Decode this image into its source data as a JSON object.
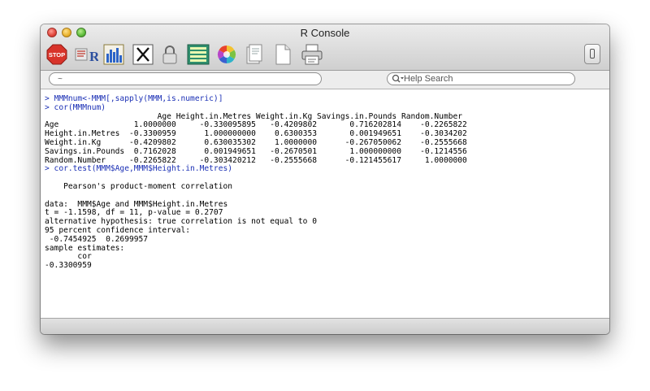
{
  "window": {
    "title": "R Console"
  },
  "toolbar": {
    "stop_label": "STOP"
  },
  "pathbar": {
    "path": "~"
  },
  "search": {
    "placeholder": "Help Search"
  },
  "console": {
    "lines": [
      {
        "kind": "cmd",
        "text": "> MMMnum<-MMM[,sapply(MMM,is.numeric)]"
      },
      {
        "kind": "cmd",
        "text": "> cor(MMMnum)"
      },
      {
        "kind": "out",
        "text": "                        Age Height.in.Metres Weight.in.Kg Savings.in.Pounds Random.Number"
      },
      {
        "kind": "out",
        "text": "Age                1.0000000     -0.330095895   -0.4209802       0.716202814    -0.2265822"
      },
      {
        "kind": "out",
        "text": "Height.in.Metres  -0.3300959      1.000000000    0.6300353       0.001949651    -0.3034202"
      },
      {
        "kind": "out",
        "text": "Weight.in.Kg      -0.4209802      0.630035302    1.0000000      -0.267050062    -0.2555668"
      },
      {
        "kind": "out",
        "text": "Savings.in.Pounds  0.7162028      0.001949651   -0.2670501       1.000000000    -0.1214556"
      },
      {
        "kind": "out",
        "text": "Random.Number     -0.2265822     -0.303420212   -0.2555668      -0.121455617     1.0000000"
      },
      {
        "kind": "cmd",
        "text": "> cor.test(MMM$Age,MMM$Height.in.Metres)"
      },
      {
        "kind": "out",
        "text": ""
      },
      {
        "kind": "out",
        "text": "    Pearson's product-moment correlation"
      },
      {
        "kind": "out",
        "text": ""
      },
      {
        "kind": "out",
        "text": "data:  MMM$Age and MMM$Height.in.Metres"
      },
      {
        "kind": "out",
        "text": "t = -1.1598, df = 11, p-value = 0.2707"
      },
      {
        "kind": "out",
        "text": "alternative hypothesis: true correlation is not equal to 0"
      },
      {
        "kind": "out",
        "text": "95 percent confidence interval:"
      },
      {
        "kind": "out",
        "text": " -0.7454925  0.2699957"
      },
      {
        "kind": "out",
        "text": "sample estimates:"
      },
      {
        "kind": "out",
        "text": "       cor"
      },
      {
        "kind": "out",
        "text": "-0.3300959"
      }
    ]
  },
  "colors": {
    "command": "#1a2fb5",
    "output": "#000000"
  }
}
